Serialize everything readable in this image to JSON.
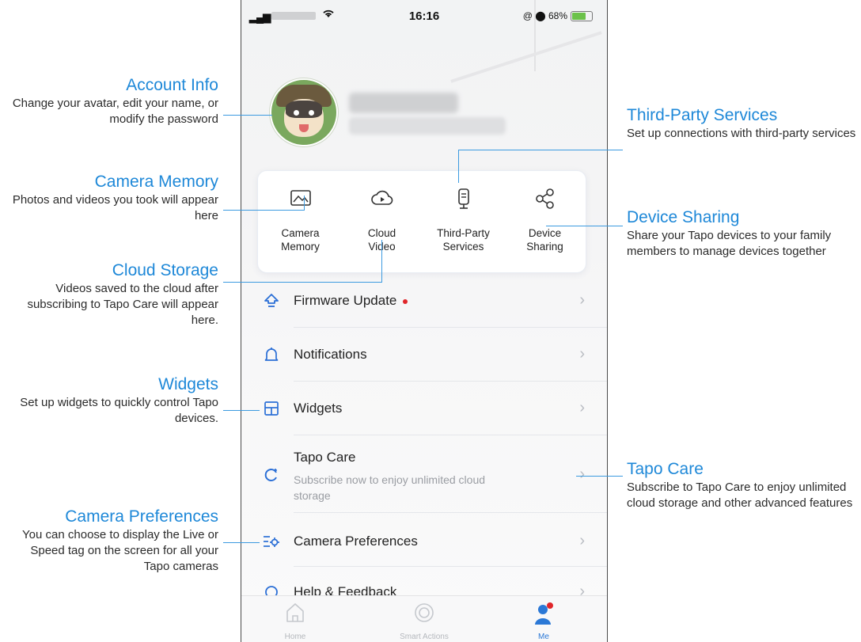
{
  "status_bar": {
    "signal": "..ıl",
    "time": "16:16",
    "right": "@ ⬤ 68%"
  },
  "tiles": [
    {
      "label": "Camera\nMemory",
      "icon": "camera-memory-icon"
    },
    {
      "label": "Cloud\nVideo",
      "icon": "cloud-video-icon"
    },
    {
      "label": "Third-Party\nServices",
      "icon": "third-party-services-icon"
    },
    {
      "label": "Device\nSharing",
      "icon": "share-icon"
    }
  ],
  "menu": [
    {
      "title": "Firmware Update",
      "icon": "firmware-update-icon",
      "badge": true
    },
    {
      "title": "Notifications",
      "icon": "bell-icon"
    },
    {
      "title": "Widgets",
      "icon": "widgets-icon"
    },
    {
      "title": "Tapo Care",
      "subtitle": "Subscribe now to enjoy unlimited cloud storage",
      "icon": "tapo-care-icon"
    },
    {
      "title": "Camera Preferences",
      "icon": "camera-preferences-icon"
    },
    {
      "title": "Help & Feedback",
      "icon": "help-icon"
    }
  ],
  "tabs": [
    {
      "label": "Home",
      "icon": "home-icon"
    },
    {
      "label": "Smart Actions",
      "icon": "smart-actions-icon"
    },
    {
      "label": "Me",
      "icon": "me-icon",
      "active": true
    }
  ],
  "annotations": {
    "account_info": {
      "title": "Account Info",
      "desc": "Change your avatar, edit your name, or modify the password"
    },
    "camera_memory": {
      "title": "Camera Memory",
      "desc": "Photos and videos you took will appear here"
    },
    "cloud_storage": {
      "title": "Cloud Storage",
      "desc": "Videos saved to the cloud after subscribing to Tapo Care will appear here."
    },
    "widgets": {
      "title": "Widgets",
      "desc": "Set up widgets to quickly control Tapo devices."
    },
    "camera_preferences": {
      "title": "Camera Preferences",
      "desc": "You can choose to display the Live or Speed tag on the screen for all your Tapo cameras"
    },
    "third_party": {
      "title": "Third-Party Services",
      "desc": "Set up connections with third-party services"
    },
    "device_sharing": {
      "title": "Device Sharing",
      "desc": "Share your Tapo devices to your family members to manage devices together"
    },
    "tapo_care": {
      "title": "Tapo Care",
      "desc": "Subscribe to Tapo Care to enjoy unlimited cloud storage and other advanced features"
    }
  },
  "colors": {
    "accent": "#1e88d8",
    "tab_active": "#2b78d6",
    "badge": "#e0262a"
  }
}
